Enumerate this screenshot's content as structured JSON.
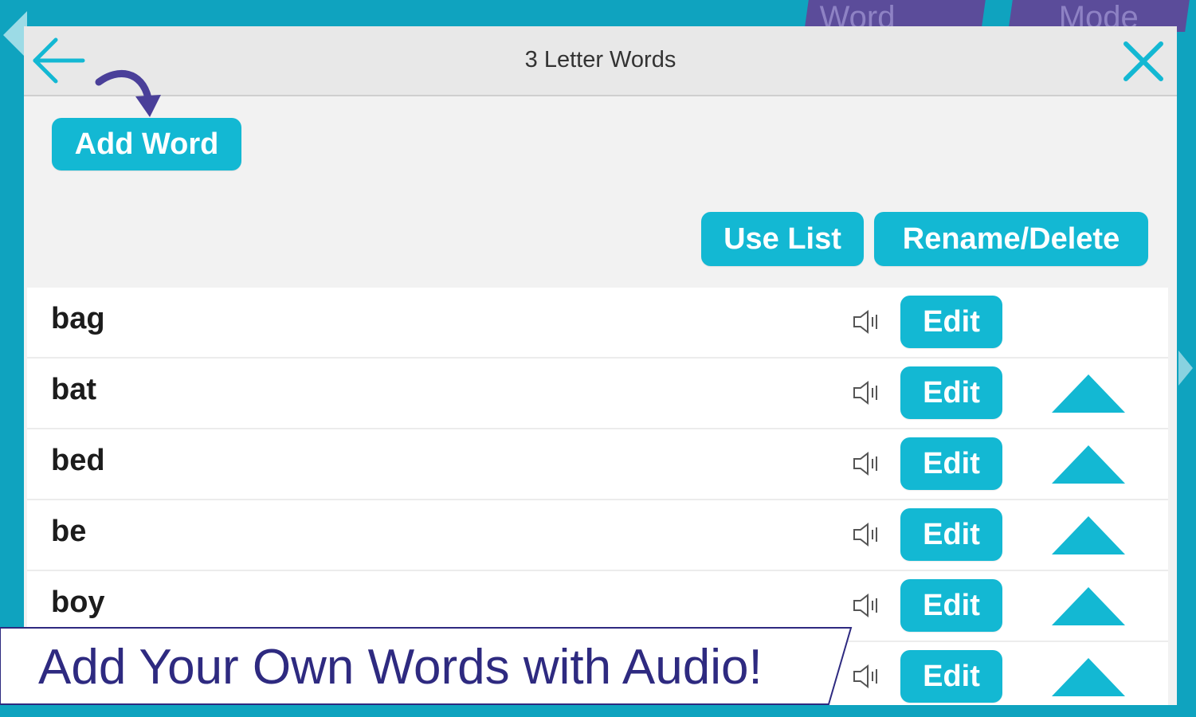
{
  "background_tabs": {
    "word_lists": "Word Lists",
    "mode": "Mode"
  },
  "header": {
    "title": "3 Letter Words",
    "back_icon": "arrow-left-icon",
    "close_icon": "close-icon"
  },
  "toolbar": {
    "add_word_label": "Add Word",
    "use_list_label": "Use List",
    "rename_delete_label": "Rename/Delete"
  },
  "words": [
    {
      "word": "bag",
      "edit_label": "Edit",
      "has_move_up": false
    },
    {
      "word": "bat",
      "edit_label": "Edit",
      "has_move_up": true
    },
    {
      "word": "bed",
      "edit_label": "Edit",
      "has_move_up": true
    },
    {
      "word": "be",
      "edit_label": "Edit",
      "has_move_up": true
    },
    {
      "word": "boy",
      "edit_label": "Edit",
      "has_move_up": true
    },
    {
      "word": "",
      "edit_label": "Edit",
      "has_move_up": true
    }
  ],
  "promo": {
    "text": "Add Your Own Words with Audio!"
  },
  "colors": {
    "accent": "#13b8d3",
    "frame": "#0fa3bf",
    "tab_purple": "#5b4c9a",
    "promo_text": "#2e2a80"
  }
}
